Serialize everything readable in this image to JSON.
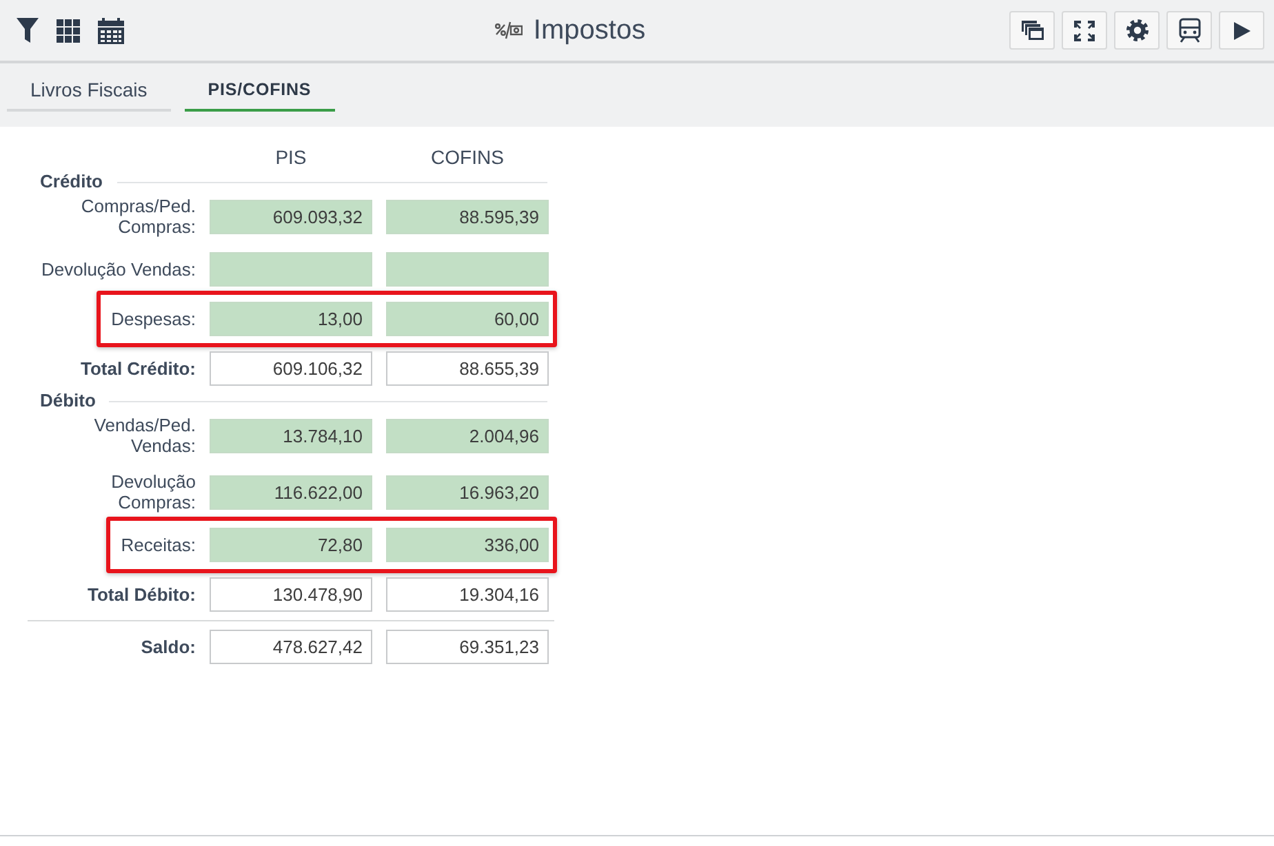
{
  "header": {
    "title": "Impostos"
  },
  "tabs": [
    {
      "label": "Livros Fiscais",
      "selected": false
    },
    {
      "label": "PIS/COFINS",
      "selected": true
    }
  ],
  "form": {
    "columns": [
      "PIS",
      "COFINS"
    ],
    "sections": [
      {
        "title": "Crédito",
        "rows": [
          {
            "kind": "input",
            "label": "Compras/Ped. Compras:",
            "values": [
              "609.093,32",
              "88.595,39"
            ],
            "highlighted": false
          },
          {
            "kind": "input",
            "label": "Devolução Vendas:",
            "highlighted": false
          },
          {
            "kind": "input",
            "label": "Despesas:",
            "values": [
              "13,00",
              "60,00"
            ],
            "highlighted": true
          },
          {
            "kind": "total",
            "label": "Total Crédito:",
            "values": [
              "609.106,32",
              "88.655,39"
            ],
            "highlighted": false
          }
        ]
      },
      {
        "title": "Débito",
        "rows": [
          {
            "kind": "input",
            "label": "Vendas/Ped. Vendas:",
            "values": [
              "13.784,10",
              "2.004,96"
            ],
            "highlighted": false
          },
          {
            "kind": "input",
            "label": "Devolução Compras:",
            "values": [
              "116.622,00",
              "16.963,20"
            ],
            "highlighted": false
          },
          {
            "kind": "input",
            "label": "Receitas:",
            "values": [
              "72,80",
              "336,00"
            ],
            "highlighted": true
          },
          {
            "kind": "total",
            "label": "Total Débito:",
            "values": [
              "130.478,90",
              "19.304,16"
            ],
            "highlighted": false
          }
        ]
      }
    ],
    "summary": [
      {
        "kind": "total",
        "label": "Saldo:",
        "values": [
          "478.627,42",
          "69.351,23"
        ],
        "highlighted": false
      }
    ]
  }
}
